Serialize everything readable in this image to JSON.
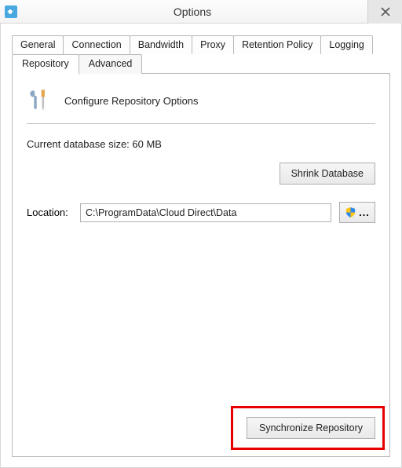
{
  "window": {
    "title": "Options"
  },
  "tabs_row1": [
    {
      "label": "General"
    },
    {
      "label": "Connection"
    },
    {
      "label": "Bandwidth"
    },
    {
      "label": "Proxy"
    },
    {
      "label": "Retention Policy"
    },
    {
      "label": "Logging"
    }
  ],
  "tabs_row2": [
    {
      "label": "Repository",
      "active": true
    },
    {
      "label": "Advanced",
      "active": false
    }
  ],
  "repository": {
    "heading": "Configure Repository Options",
    "dbsize_label": "Current database size: 60 MB",
    "shrink_label": "Shrink Database",
    "location_label": "Location:",
    "location_value": "C:\\ProgramData\\Cloud Direct\\Data",
    "browse_ellipsis": "...",
    "sync_label": "Synchronize Repository"
  }
}
